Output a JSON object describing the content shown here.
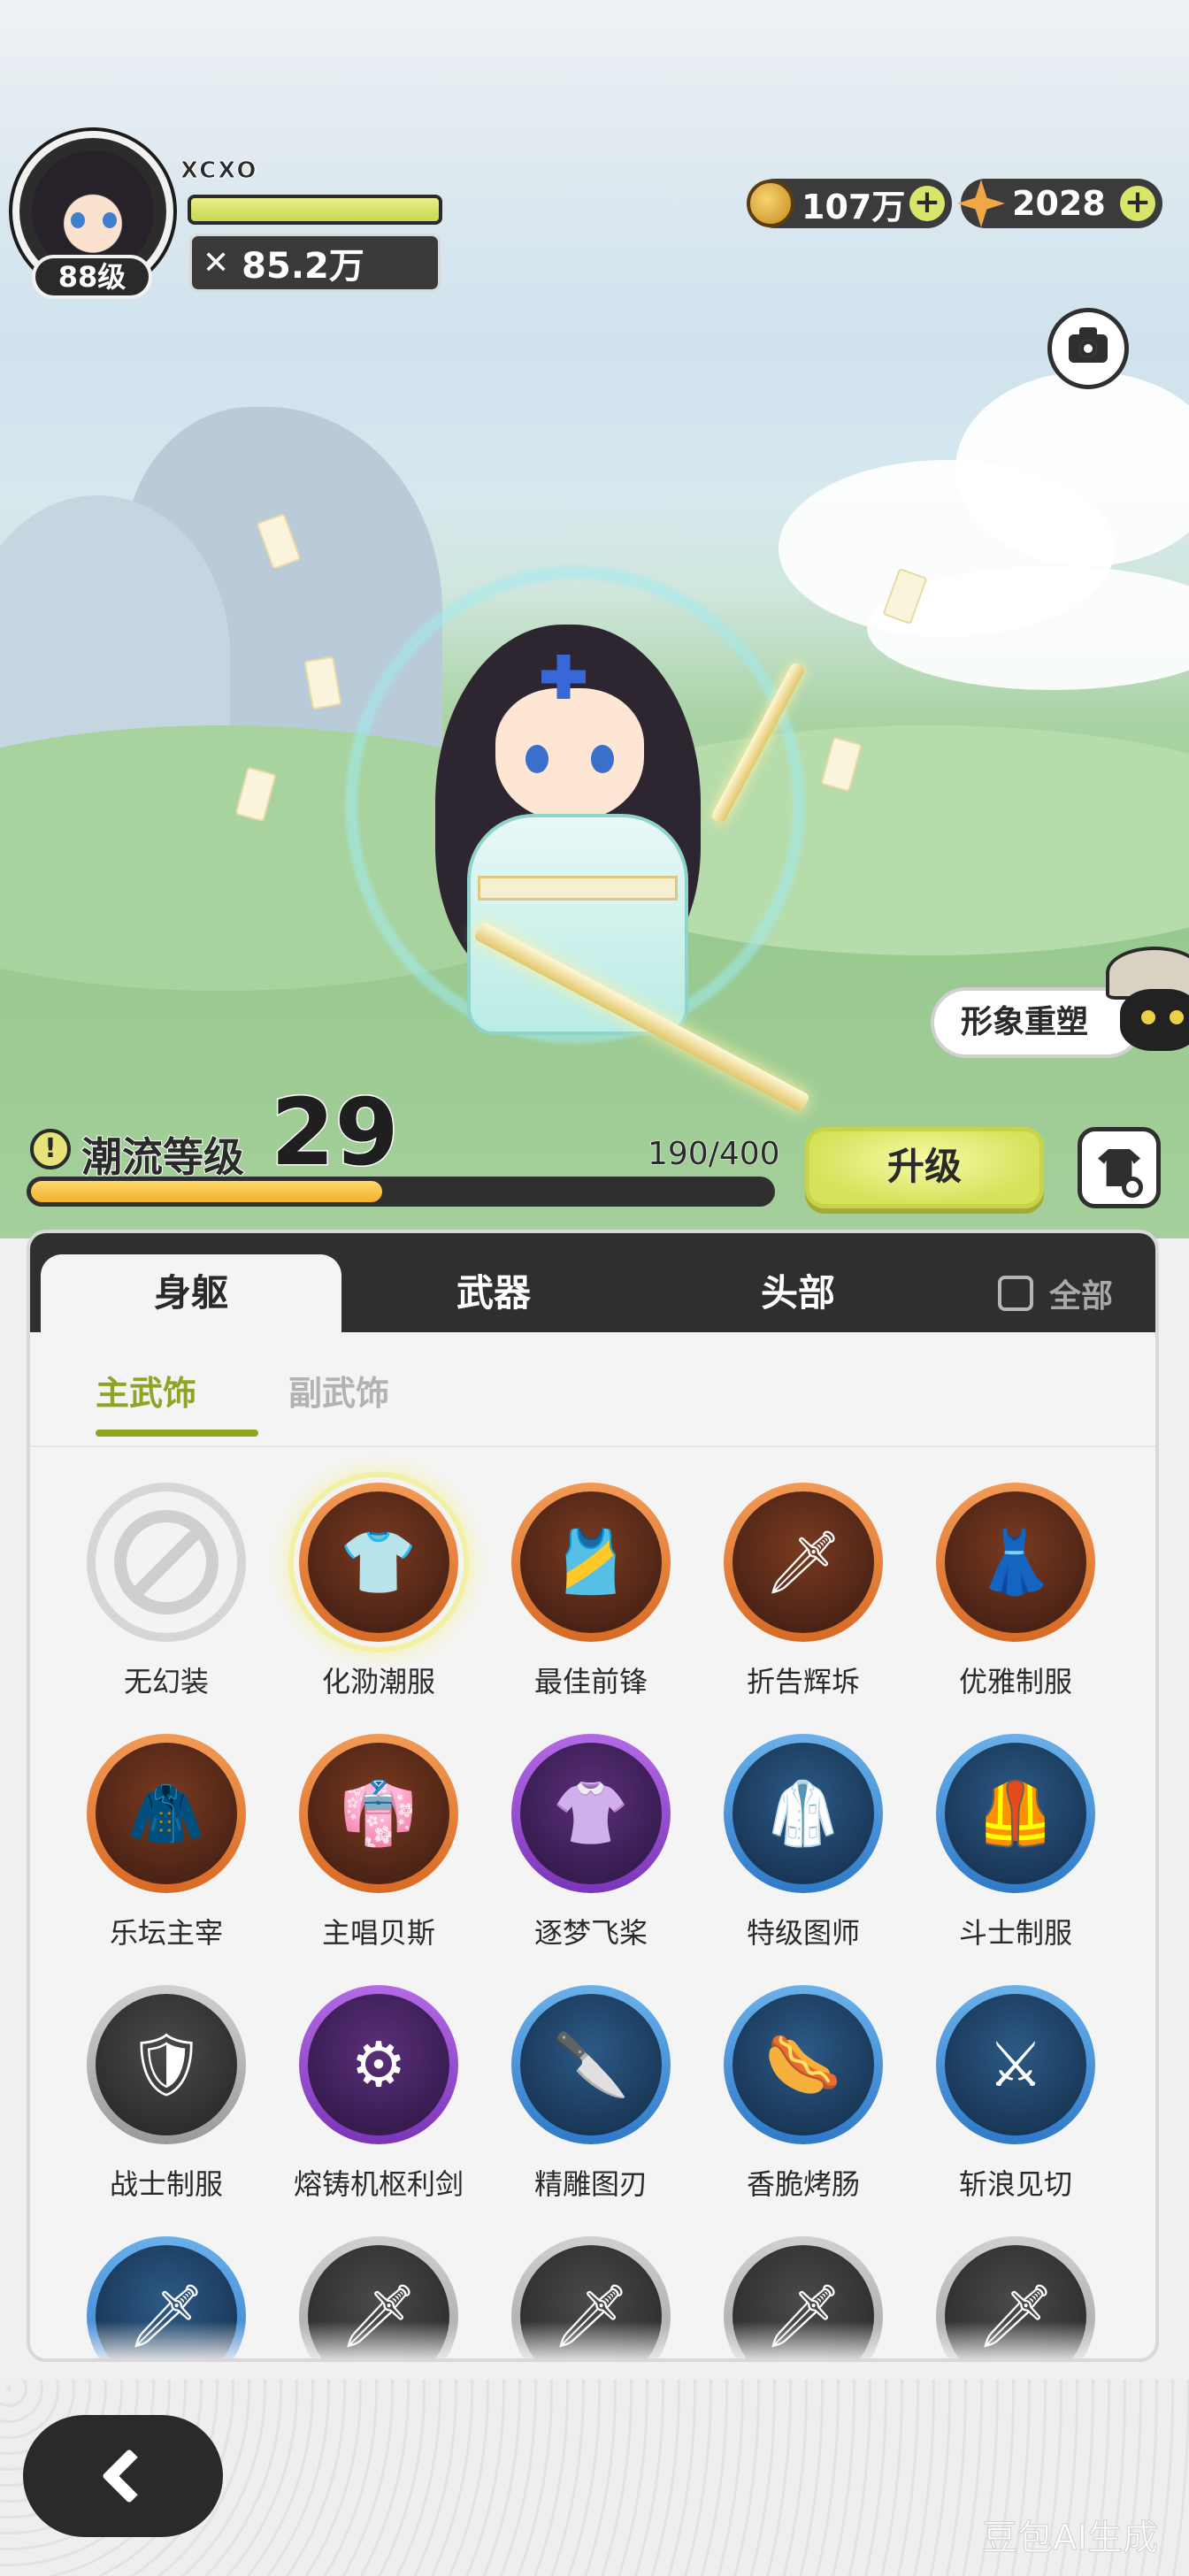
{
  "header": {
    "player_name": "XCXO",
    "player_level": "88级",
    "power_icon": "crossed-swords-icon",
    "power_value": "85.2万",
    "hp_fraction": 1.0
  },
  "currency": {
    "gold": {
      "icon": "coin-icon",
      "value": "107万"
    },
    "gem": {
      "icon": "star-gem-icon",
      "value": "2028"
    }
  },
  "scene": {
    "reshape_label": "形象重塑"
  },
  "trend": {
    "label": "潮流等级",
    "level": "29",
    "progress_text": "190/400",
    "progress_current": 190,
    "progress_max": 400,
    "upgrade_label": "升级"
  },
  "tabs": {
    "items": [
      {
        "label": "身躯",
        "active": true
      },
      {
        "label": "武器",
        "active": false
      },
      {
        "label": "头部",
        "active": false
      }
    ],
    "all_label": "全部"
  },
  "subtabs": [
    {
      "label": "主武饰",
      "active": true
    },
    {
      "label": "副武饰",
      "active": false
    }
  ],
  "items": [
    {
      "label": "无幻装",
      "rarity": "none",
      "icon": "⊘"
    },
    {
      "label": "化泐潮服",
      "rarity": "orange",
      "icon": "👕",
      "selected": true
    },
    {
      "label": "最佳前锋",
      "rarity": "orange",
      "icon": "🎽"
    },
    {
      "label": "折告辉坼",
      "rarity": "orange",
      "icon": "🗡"
    },
    {
      "label": "优雅制服",
      "rarity": "orange",
      "icon": "👗"
    },
    {
      "label": "乐坛主宰",
      "rarity": "orange",
      "icon": "🧥"
    },
    {
      "label": "主唱贝斯",
      "rarity": "orange",
      "icon": "👘"
    },
    {
      "label": "逐梦飞桨",
      "rarity": "purple",
      "icon": "👚"
    },
    {
      "label": "特级图师",
      "rarity": "blue",
      "icon": "🥼"
    },
    {
      "label": "斗士制服",
      "rarity": "blue",
      "icon": "🦺"
    },
    {
      "label": "战士制服",
      "rarity": "gray",
      "icon": "🛡"
    },
    {
      "label": "熔铸机枢利剑",
      "rarity": "purple",
      "icon": "⚙"
    },
    {
      "label": "精雕图刃",
      "rarity": "blue",
      "icon": "🔪"
    },
    {
      "label": "香脆烤肠",
      "rarity": "blue",
      "icon": "🌭"
    },
    {
      "label": "斩浪见切",
      "rarity": "blue",
      "icon": "⚔"
    },
    {
      "label": "",
      "rarity": "blue",
      "icon": "🗡"
    },
    {
      "label": "",
      "rarity": "gray",
      "icon": "🗡"
    },
    {
      "label": "",
      "rarity": "gray",
      "icon": "🗡"
    },
    {
      "label": "",
      "rarity": "gray",
      "icon": "🗡"
    },
    {
      "label": "",
      "rarity": "gray",
      "icon": "🗡"
    }
  ],
  "footer": {
    "back_icon": "chevron-left-icon",
    "watermark": "豆包AI生成"
  },
  "colors": {
    "accent": "#8ea524",
    "upgrade": "#d5e35c",
    "dark": "#2f2f2f"
  }
}
